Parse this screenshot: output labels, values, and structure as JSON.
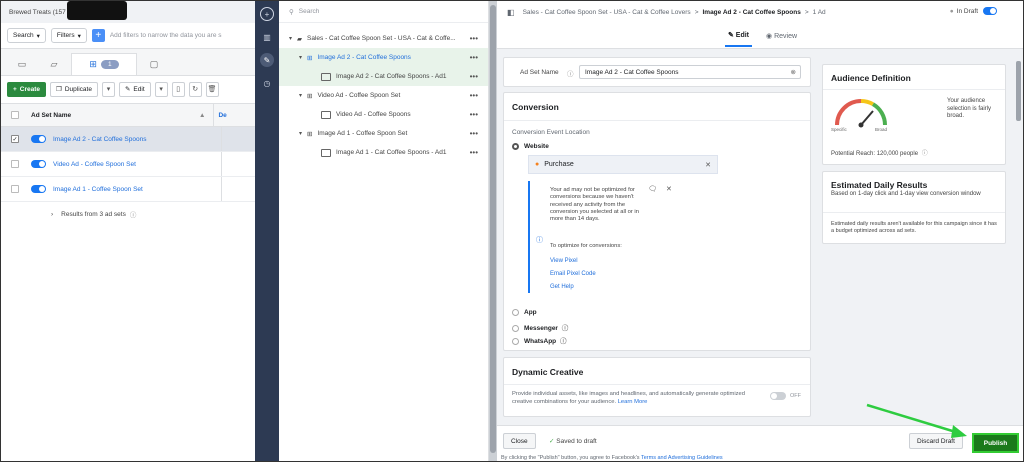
{
  "account": {
    "name": "Brewed Treats (157"
  },
  "left": {
    "search_label": "Search",
    "filters_label": "Filters",
    "filter_placeholder": "Add filters to narrow the data you are s",
    "selected_badge": "1",
    "toolbar": {
      "create_label": "Create",
      "duplicate_label": "Duplicate",
      "edit_label": "Edit"
    },
    "table": {
      "header_name": "Ad Set Name",
      "rows": [
        {
          "name": "Image Ad 2 - Cat Coffee Spoons"
        },
        {
          "name": "Video Ad - Coffee Spoon Set"
        },
        {
          "name": "Image Ad 1 - Coffee Spoon Set"
        }
      ],
      "results_text": "Results from 3 ad sets",
      "col2_header": "De"
    }
  },
  "tree": {
    "search_placeholder": "Search",
    "items": [
      {
        "label": "Sales - Cat Coffee Spoon Set - USA - Cat & Coffe..."
      },
      {
        "label": "Image Ad 2 - Cat Coffee Spoons"
      },
      {
        "label": "Image Ad 2 - Cat Coffee Spoons - Ad1"
      },
      {
        "label": "Video Ad - Coffee Spoon Set"
      },
      {
        "label": "Video Ad - Coffee Spoons"
      },
      {
        "label": "Image Ad 1 - Coffee Spoon Set"
      },
      {
        "label": "Image Ad 1 - Cat Coffee Spoons - Ad1"
      }
    ]
  },
  "editor": {
    "breadcrumb": {
      "campaign": "Sales - Cat Coffee Spoon Set - USA - Cat & Coffee Lovers",
      "sep1": ">",
      "adset": "Image Ad 2 - Cat Coffee Spoons",
      "sep2": ">",
      "ad": "1 Ad"
    },
    "status_label": "In Draft",
    "tabs": {
      "edit": "Edit",
      "review": "Review"
    },
    "adset_name_label": "Ad Set Name",
    "adset_name_value": "Image Ad 2 - Cat Coffee Spoons",
    "conversion": {
      "title": "Conversion",
      "location_label": "Conversion Event Location",
      "website_label": "Website",
      "event_value": "Purchase",
      "warning_text": "Your ad may not be optimized for conversions because we haven't received any activity from the conversion you selected at all or in more than 14 days.",
      "optimize_text": "To optimize for conversions:",
      "links": [
        "View Pixel",
        "Email Pixel Code",
        "Get Help"
      ],
      "options": [
        "App",
        "Messenger",
        "WhatsApp"
      ]
    },
    "dynamic": {
      "title": "Dynamic Creative",
      "desc": "Provide individual assets, like images and headlines, and automatically generate optimized creative combinations for your audience.",
      "learn_more": "Learn More",
      "toggle_state": "OFF"
    },
    "audience": {
      "title": "Audience Definition",
      "gauge_left": "Specific",
      "gauge_right": "Broad",
      "summary": "Your audience selection is fairly broad.",
      "reach": "Potential Reach: 120,000 people"
    },
    "daily": {
      "title": "Estimated Daily Results",
      "subtitle": "Based on 1-day click and 1-day view conversion window",
      "note": "Estimated daily results aren't available for this campaign since it has a budget optimized across ad sets."
    },
    "footer": {
      "close_label": "Close",
      "saved_label": "Saved to draft",
      "discard_label": "Discard Draft",
      "publish_label": "Publish",
      "terms_prefix": "By clicking the \"Publish\" button, you agree to Facebook's",
      "terms_link": "Terms and Advertising Guidelines"
    }
  },
  "colors": {
    "accent": "#1877f2",
    "publish": "#1b7a1b",
    "arrow": "#2ecc40",
    "rail": "#2d3a53"
  }
}
